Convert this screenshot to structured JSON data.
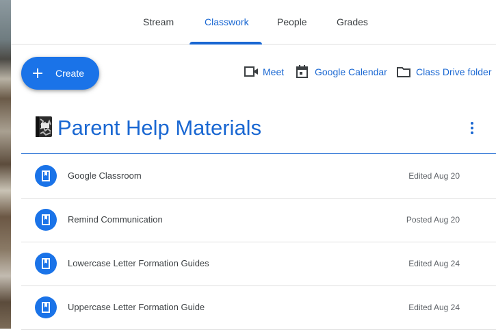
{
  "nav": {
    "tabs": [
      {
        "label": "Stream",
        "active": false
      },
      {
        "label": "Classwork",
        "active": true
      },
      {
        "label": "People",
        "active": false
      },
      {
        "label": "Grades",
        "active": false
      }
    ]
  },
  "toolbar": {
    "create_label": "Create",
    "meet_label": "Meet",
    "calendar_label": "Google Calendar",
    "drive_label": "Class Drive folder"
  },
  "topic": {
    "title": "Parent Help Materials",
    "materials": [
      {
        "name": "Google Classroom",
        "meta": "Edited Aug 20",
        "icon": "material-icon"
      },
      {
        "name": "Remind Communication",
        "meta": "Posted Aug 20",
        "icon": "material-icon"
      },
      {
        "name": "Lowercase Letter Formation Guides",
        "meta": "Edited Aug 24",
        "icon": "material-icon"
      },
      {
        "name": "Uppercase Letter Formation Guide",
        "meta": "Edited Aug 24",
        "icon": "material-icon"
      }
    ]
  },
  "colors": {
    "accent": "#1967d2",
    "button": "#1a73e8",
    "text": "#3c4043",
    "meta_text": "#5f6368"
  }
}
